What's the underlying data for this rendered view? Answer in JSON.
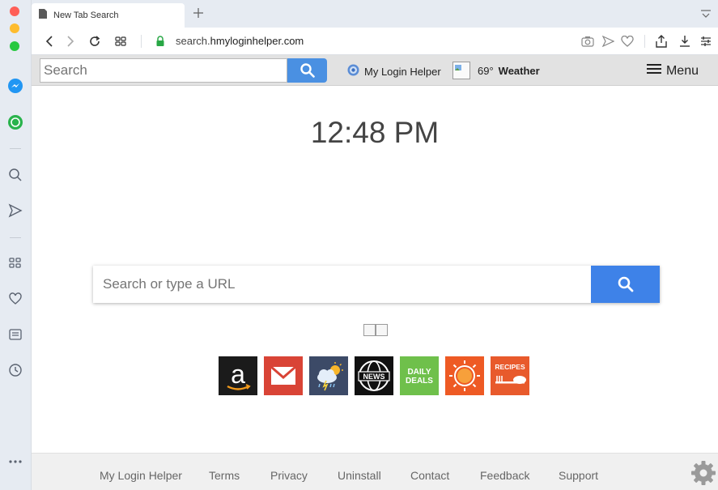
{
  "browser": {
    "tab_title": "New Tab Search",
    "url_host": "search.",
    "url_domain": "hmyloginhelper.com"
  },
  "toolbar": {
    "search_placeholder": "Search",
    "brand": "My Login Helper",
    "weather_temp": "69°",
    "weather_label": "Weather",
    "menu_label": "Menu"
  },
  "main": {
    "clock": "12:48 PM",
    "search_placeholder": "Search or type a URL"
  },
  "tiles": [
    {
      "name": "amazon",
      "label": "a"
    },
    {
      "name": "gmail",
      "label": ""
    },
    {
      "name": "weather",
      "label": ""
    },
    {
      "name": "news",
      "label": "NEWS"
    },
    {
      "name": "daily-deals",
      "label": "DAILY DEALS"
    },
    {
      "name": "sun",
      "label": ""
    },
    {
      "name": "recipes",
      "label": "RECIPES"
    }
  ],
  "footer": {
    "links": [
      "My Login Helper",
      "Terms",
      "Privacy",
      "Uninstall",
      "Contact",
      "Feedback",
      "Support"
    ]
  },
  "colors": {
    "accent_blue": "#3e82e8",
    "sidebar_bg": "#e6ebf2",
    "toolbar_bg": "#e2e2e2"
  }
}
